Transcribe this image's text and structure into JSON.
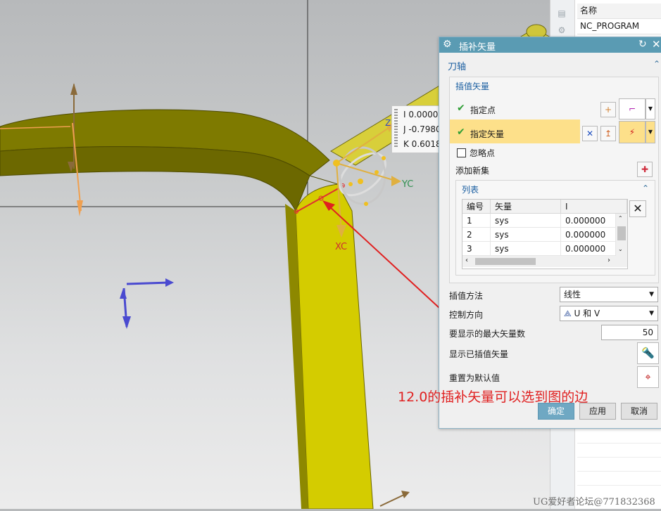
{
  "coord_readout": {
    "i": "I  0.00000",
    "j": "J  -0.7980",
    "k": "K  0.6018"
  },
  "axis_labels": {
    "yc": "YC",
    "xc": "XC",
    "zc": "Z"
  },
  "navigator": {
    "header": "名称",
    "item": "NC_PROGRAM"
  },
  "dialog": {
    "title": "插补矢量",
    "section_tool_axis": "刀轴",
    "group_interp": "插值矢量",
    "specify_point": "指定点",
    "specify_vector": "指定矢量",
    "ignore_point": "忽略点",
    "add_new_set": "添加新集",
    "list_title": "列表",
    "table": {
      "columns": [
        "编号",
        "矢量",
        "I"
      ],
      "rows": [
        [
          "1",
          "sys",
          "0.000000"
        ],
        [
          "2",
          "sys",
          "0.000000"
        ],
        [
          "3",
          "sys",
          "0.000000"
        ]
      ]
    },
    "interp_method_label": "插值方法",
    "interp_method_value": "线性",
    "control_dir_label": "控制方向",
    "control_dir_value": "U 和 V",
    "max_vectors_label": "要显示的最大矢量数",
    "max_vectors_value": "50",
    "show_interp_label": "显示已插值矢量",
    "reset_default_label": "重置为默认值",
    "ok": "确定",
    "apply": "应用",
    "cancel": "取消"
  },
  "annotation": "12.0的插补矢量可以选到图的边",
  "watermark": "UG爱好者论坛@771832368",
  "colors": {
    "titlebar": "#5a9bb3",
    "highlight_row": "#fde08a",
    "annotation": "#e02020",
    "part_face": "#d4cc00",
    "part_side": "#7a7200"
  }
}
